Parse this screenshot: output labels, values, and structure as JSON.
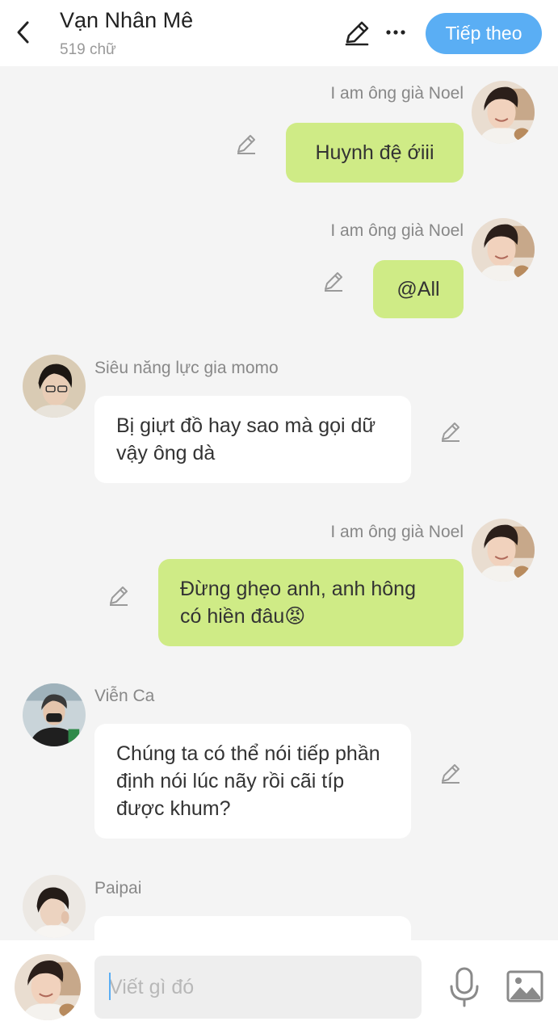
{
  "header": {
    "title": "Vạn Nhân Mê",
    "subtitle": "519 chữ",
    "next_label": "Tiếp theo"
  },
  "messages": [
    {
      "sender": "I am ông già Noel",
      "text": "Huynh đệ ớiii",
      "side": "right"
    },
    {
      "sender": "I am ông già Noel",
      "text": "@All",
      "side": "right"
    },
    {
      "sender": "Siêu năng lực gia momo",
      "text": "Bị giựt đồ hay sao mà gọi dữ vậy ông dà",
      "side": "left"
    },
    {
      "sender": "I am ông già Noel",
      "text": "Đừng ghẹo anh, anh hông có hiền đâu😡",
      "side": "right"
    },
    {
      "sender": "Viễn Ca",
      "text": "Chúng ta có thể nói tiếp phần định nói lúc nãy rồi cãi típ được khum?",
      "side": "left"
    },
    {
      "sender": "Paipai",
      "text": "",
      "side": "left"
    }
  ],
  "composer": {
    "placeholder": "Viết gì đó"
  },
  "colors": {
    "accent": "#5aaef4",
    "own_bubble": "#cfeb86",
    "other_bubble": "#ffffff",
    "background": "#f4f4f4"
  },
  "icons": [
    "back-arrow-icon",
    "pencil-icon",
    "more-icon",
    "microphone-icon",
    "image-icon"
  ]
}
